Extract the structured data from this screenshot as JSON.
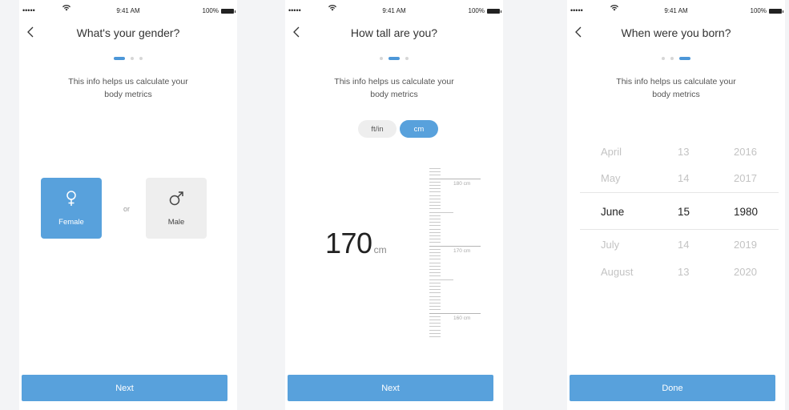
{
  "status_bar": {
    "signal": "•••••",
    "time": "9:41 AM",
    "battery": "100%"
  },
  "screens": [
    {
      "title": "What's your gender?",
      "info_line1": "This info helps us calculate your",
      "info_line2": "body metrics",
      "active_step": 1,
      "female_label": "Female",
      "male_label": "Male",
      "or_label": "or",
      "female_icon": "female-symbol",
      "male_icon": "male-symbol",
      "button_label": "Next"
    },
    {
      "title": "How tall are you?",
      "info_line1": "This info helps us calculate your",
      "info_line2": "body metrics",
      "active_step": 2,
      "unit_ftin": "ft/in",
      "unit_cm": "cm",
      "selected_unit": "cm",
      "height_value": "170",
      "height_unit": "cm",
      "ruler_labels": [
        "180 cm",
        "170 cm",
        "160 cm"
      ],
      "button_label": "Next"
    },
    {
      "title": "When were you born?",
      "info_line1": "This info helps us calculate your",
      "info_line2": "body metrics",
      "active_step": 3,
      "picker_rows": [
        {
          "month": "April",
          "day": "13",
          "year": "2016"
        },
        {
          "month": "May",
          "day": "14",
          "year": "2017"
        },
        {
          "month": "June",
          "day": "15",
          "year": "1980"
        },
        {
          "month": "July",
          "day": "14",
          "year": "2019"
        },
        {
          "month": "August",
          "day": "13",
          "year": "2020"
        }
      ],
      "selected_row": 2,
      "button_label": "Done"
    }
  ],
  "colors": {
    "accent": "#58a1dc",
    "accent_dot": "#4c97d8",
    "background": "#f3f4f6",
    "card_inactive": "#eeeeee"
  }
}
